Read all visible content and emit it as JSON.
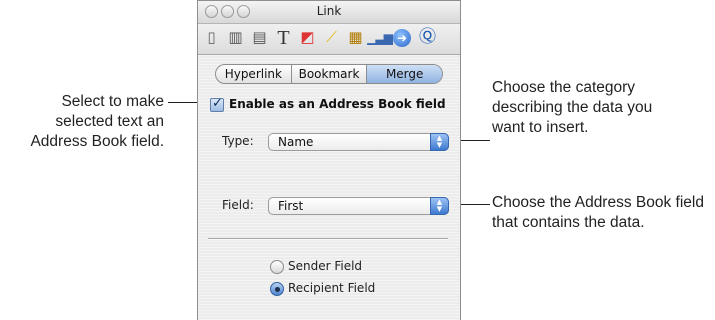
{
  "window": {
    "title": "Link"
  },
  "toolbar": {
    "icons": [
      "document-icon",
      "layout-icon",
      "wrap-icon",
      "text-icon",
      "graphic-icon",
      "metrics-icon",
      "table-icon",
      "chart-icon",
      "link-icon",
      "quicktime-icon"
    ]
  },
  "tabs": [
    "Hyperlink",
    "Bookmark",
    "Merge"
  ],
  "active_tab": "Merge",
  "enable_checkbox": {
    "label": "Enable as an Address Book field",
    "checked": true
  },
  "type_field": {
    "label": "Type:",
    "value": "Name"
  },
  "field_field": {
    "label": "Field:",
    "value": "First"
  },
  "radios": [
    {
      "label": "Sender Field",
      "selected": false
    },
    {
      "label": "Recipient Field",
      "selected": true
    }
  ],
  "callouts": {
    "left": "Select to make selected text an Address Book field.",
    "right_1": "Choose the category describing the data you want to insert.",
    "right_2": "Choose the Address Book field that contains the data."
  }
}
